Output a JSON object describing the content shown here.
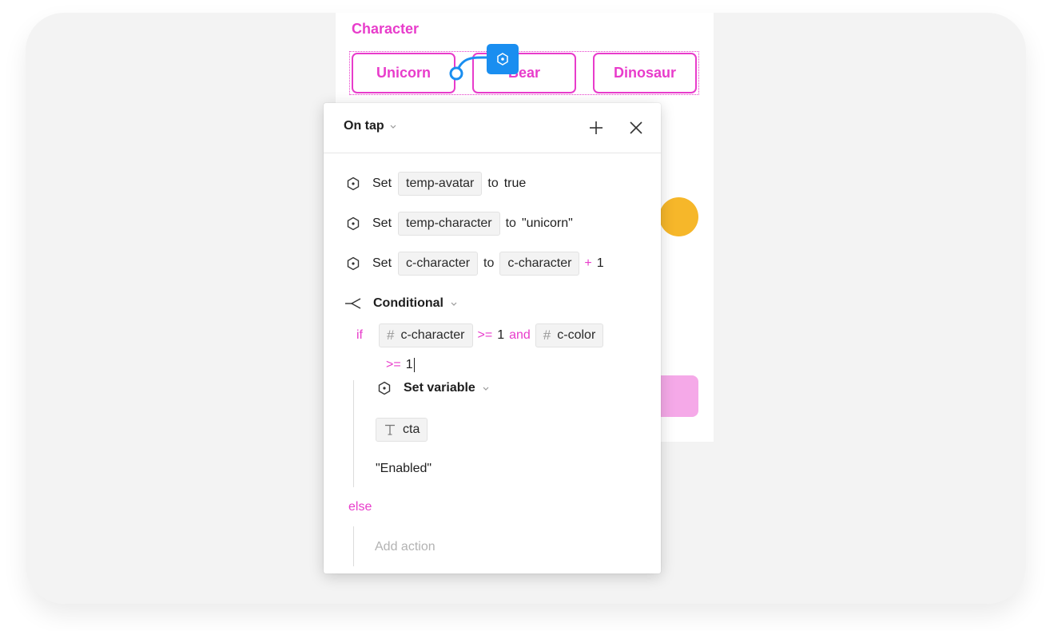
{
  "canvas": {
    "section_label": "Character",
    "chips": [
      {
        "label": "Unicorn"
      },
      {
        "label": "Bear"
      },
      {
        "label": "Dinosaur"
      }
    ],
    "colors": {
      "accent": "#e83ccb",
      "badge": "#1a8ef0",
      "dot": "#f6b72a",
      "button": "#f5a9e8"
    }
  },
  "popover": {
    "trigger": "On tap",
    "actions": [
      {
        "verb": "Set",
        "variable": "temp-avatar",
        "connector": "to",
        "value": "true"
      },
      {
        "verb": "Set",
        "variable": "temp-character",
        "connector": "to",
        "value": "\"unicorn\""
      },
      {
        "verb": "Set",
        "variable": "c-character",
        "connector": "to",
        "value_token": "c-character",
        "operator": "+",
        "operand": "1"
      }
    ],
    "conditional": {
      "label": "Conditional",
      "if_keyword": "if",
      "left_var": "c-character",
      "op1": ">=",
      "val1": "1",
      "and_keyword": "and",
      "right_var": "c-color",
      "op2": ">=",
      "val2": "1",
      "nested": {
        "label": "Set variable",
        "variable": "cta",
        "value": "\"Enabled\""
      },
      "else_keyword": "else",
      "else_placeholder": "Add action"
    }
  }
}
